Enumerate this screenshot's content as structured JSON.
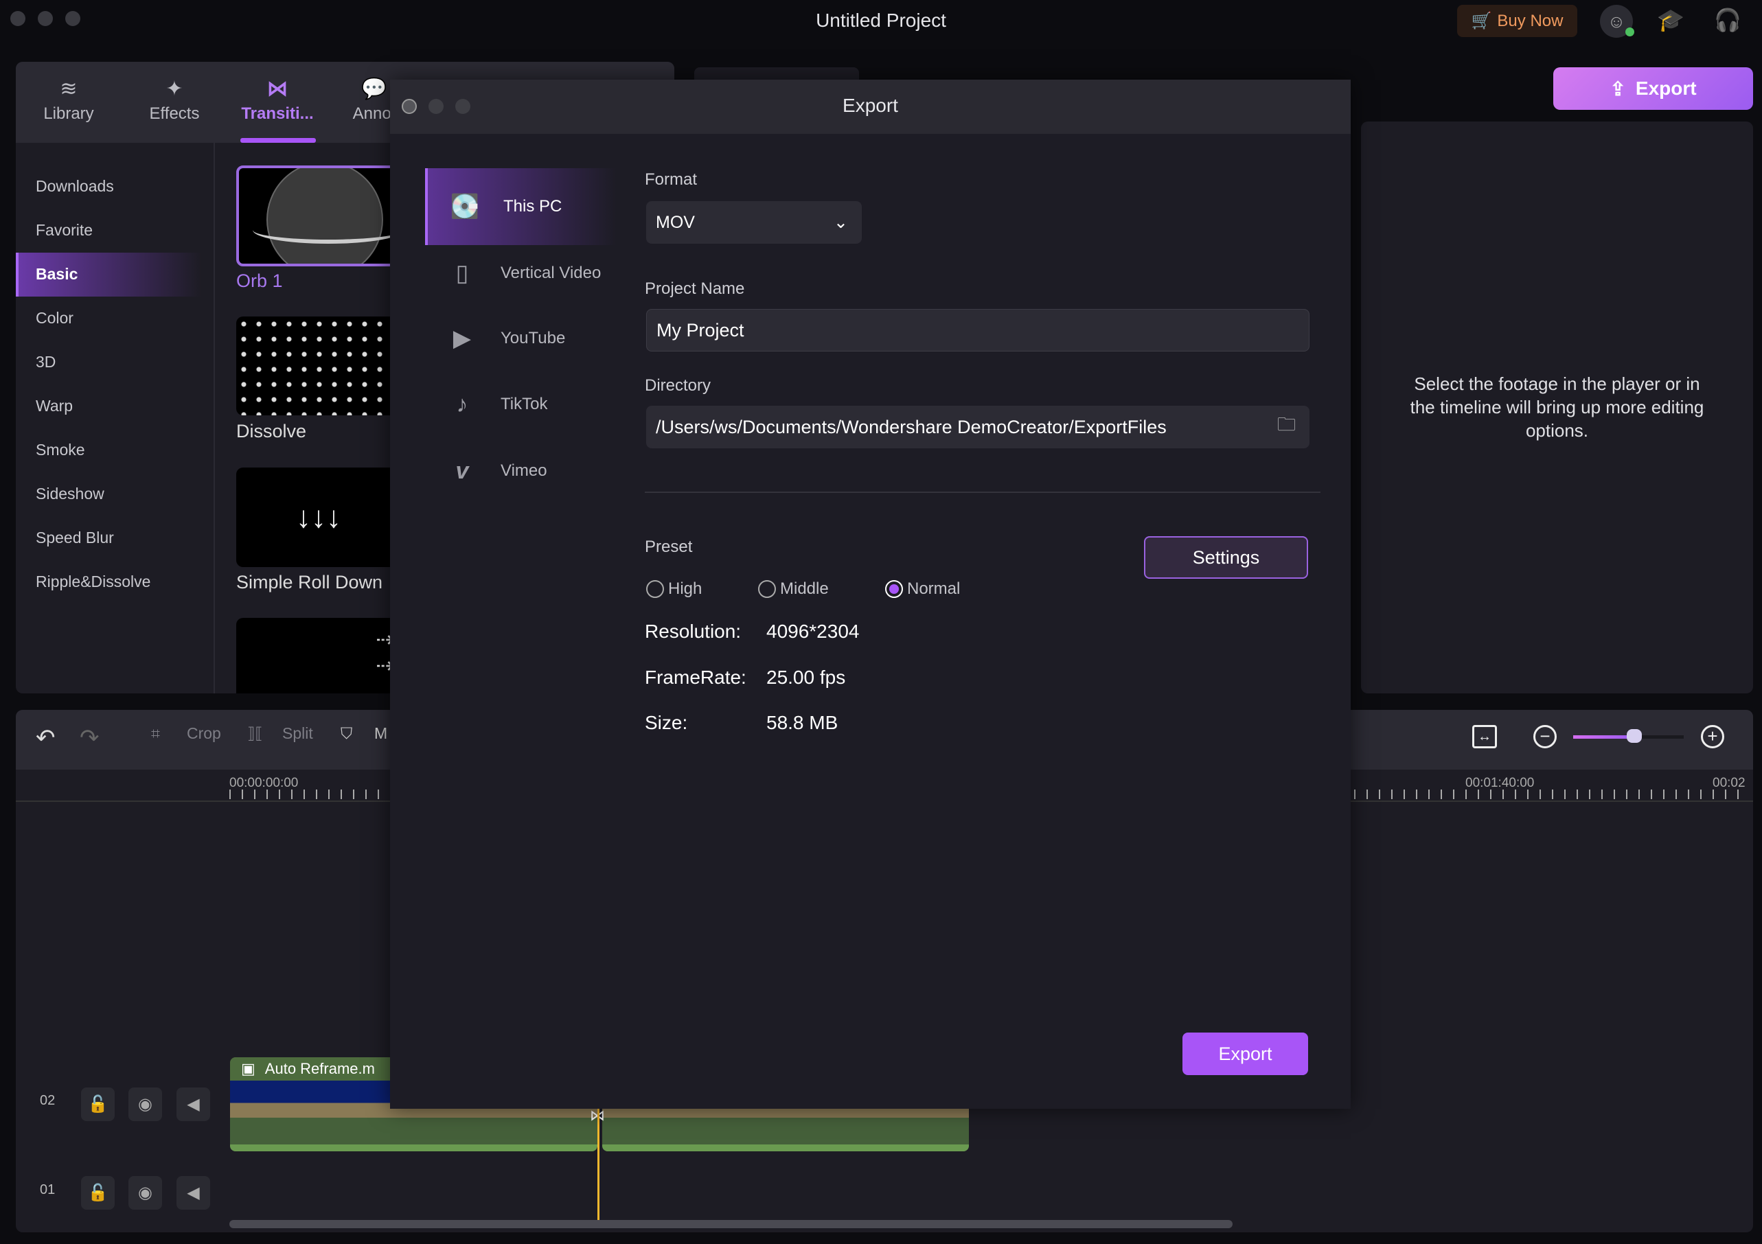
{
  "window": {
    "title": "Untitled Project"
  },
  "header": {
    "buy_now": "Buy Now",
    "export": "Export"
  },
  "left_tabs": [
    {
      "label": "Library",
      "icon": "layers-icon"
    },
    {
      "label": "Effects",
      "icon": "sparkle-icon"
    },
    {
      "label": "Transiti...",
      "icon": "transition-icon",
      "active": true
    },
    {
      "label": "Annot",
      "icon": "annotation-icon"
    }
  ],
  "categories": [
    "Downloads",
    "Favorite",
    "Basic",
    "Color",
    "3D",
    "Warp",
    "Smoke",
    "Sideshow",
    "Speed Blur",
    "Ripple&Dissolve"
  ],
  "selected_category": "Basic",
  "transitions": [
    "Orb 1",
    "Dissolve",
    "Simple Roll Down"
  ],
  "properties": {
    "hint": "Select the footage in the player or in the timeline will bring up more editing options."
  },
  "toolbar": {
    "crop": "Crop",
    "split": "Split",
    "marker": "M",
    "zoom_level": 0.55
  },
  "ruler": [
    "00:00:00:00",
    "00:01:40:00",
    "00:02"
  ],
  "tracks": [
    {
      "label": "02",
      "clip": "Auto Reframe.m"
    },
    {
      "label": "01"
    }
  ],
  "dialog": {
    "title": "Export",
    "nav": [
      {
        "label": "This PC",
        "icon": "hard-drive-icon",
        "active": true
      },
      {
        "label": "Vertical Video",
        "icon": "phone-icon"
      },
      {
        "label": "YouTube",
        "icon": "youtube-icon"
      },
      {
        "label": "TikTok",
        "icon": "tiktok-icon"
      },
      {
        "label": "Vimeo",
        "icon": "vimeo-icon"
      }
    ],
    "format_label": "Format",
    "format": "MOV",
    "project_name_label": "Project Name",
    "project_name": "My Project",
    "directory_label": "Directory",
    "directory": "/Users/ws/Documents/Wondershare DemoCreator/ExportFiles",
    "preset_label": "Preset",
    "presets": [
      "High",
      "Middle",
      "Normal"
    ],
    "selected_preset": "Normal",
    "settings": "Settings",
    "resolution_label": "Resolution:",
    "resolution": "4096*2304",
    "framerate_label": "FrameRate:",
    "framerate": "25.00 fps",
    "size_label": "Size:",
    "size": "58.8 MB",
    "export": "Export"
  },
  "colors": {
    "accent": "#a855f7",
    "playhead": "#f5b82e",
    "clip": "#4a6a3a"
  }
}
